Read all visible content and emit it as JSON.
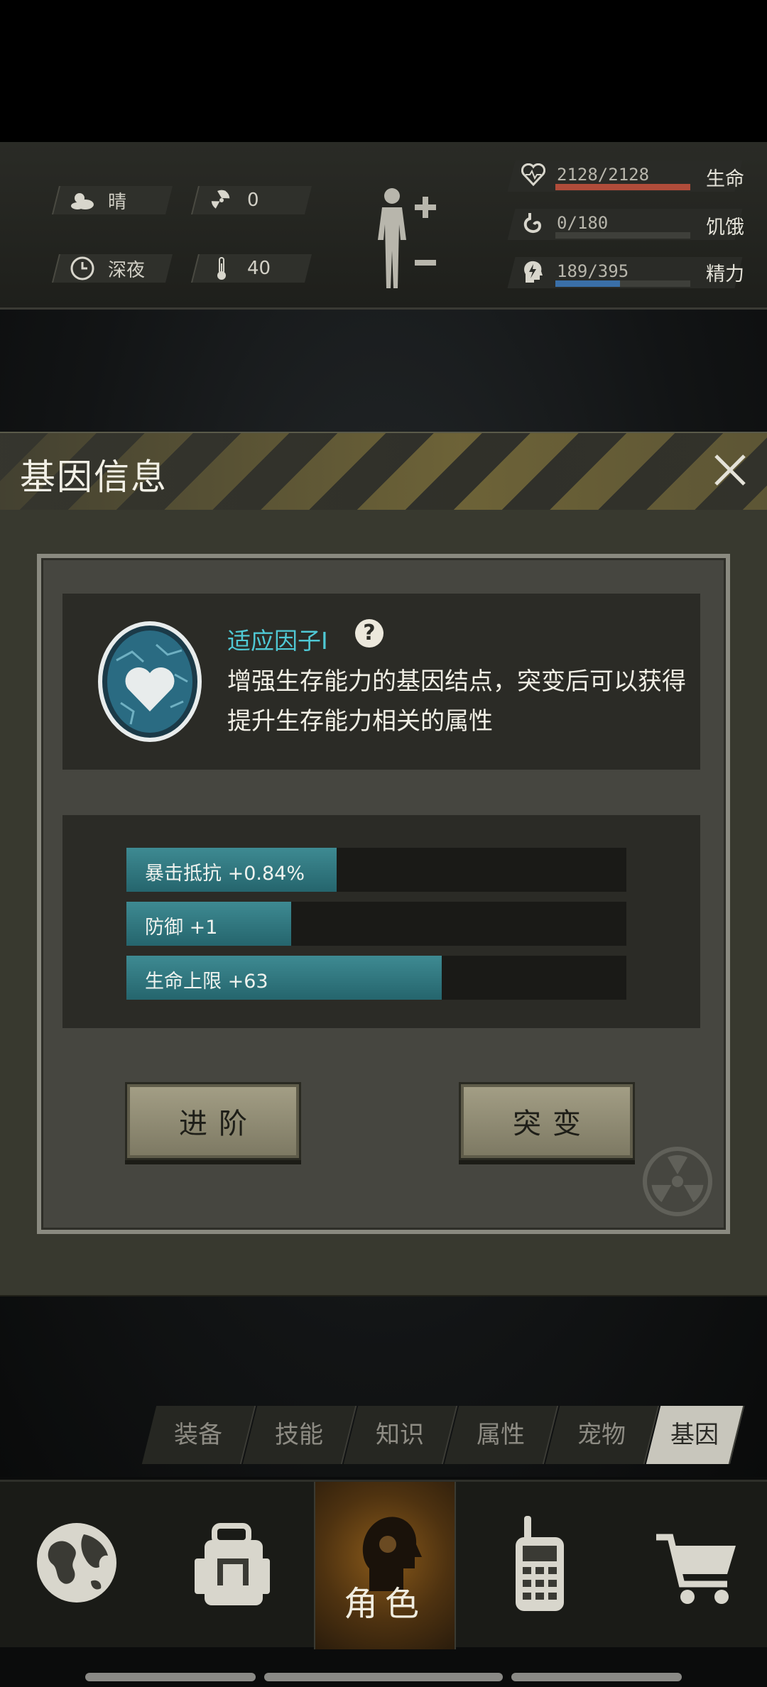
{
  "status": {
    "weather": {
      "icon": "cloudy-sun-icon",
      "label": "晴"
    },
    "radiation": {
      "icon": "radiation-icon",
      "value": "0"
    },
    "time": {
      "icon": "clock-icon",
      "label": "深夜"
    },
    "temperature": {
      "icon": "thermometer-icon",
      "value": "40"
    },
    "meters": [
      {
        "icon": "heart-icon",
        "value": "2128/2128",
        "label": "生命",
        "fill": 1.0,
        "color": "#b04c3a"
      },
      {
        "icon": "stomach-icon",
        "value": "0/180",
        "label": "饥饿",
        "fill": 0.0,
        "color": "#7a7a70"
      },
      {
        "icon": "brain-energy-icon",
        "value": "189/395",
        "label": "精力",
        "fill": 0.48,
        "color": "#3a6fa8"
      }
    ]
  },
  "modal": {
    "title": "基因信息",
    "gene_name": "适应因子Ⅰ",
    "description": "增强生存能力的基因结点，突变后可以获得提升生存能力相关的属性",
    "attributes": [
      {
        "label": "暴击抵抗 +0.84%",
        "fill": 0.42
      },
      {
        "label": "防御 +1",
        "fill": 0.33
      },
      {
        "label": "生命上限 +63",
        "fill": 0.63
      }
    ],
    "buttons": {
      "advance": "进阶",
      "mutate": "突变"
    }
  },
  "tabs": [
    "装备",
    "技能",
    "知识",
    "属性",
    "宠物",
    "基因"
  ],
  "active_tab": "基因",
  "bottom_nav": {
    "items": [
      "globe-icon",
      "backpack-icon",
      "character-icon",
      "walkie-talkie-icon",
      "cart-icon"
    ],
    "active_label": "角色"
  }
}
